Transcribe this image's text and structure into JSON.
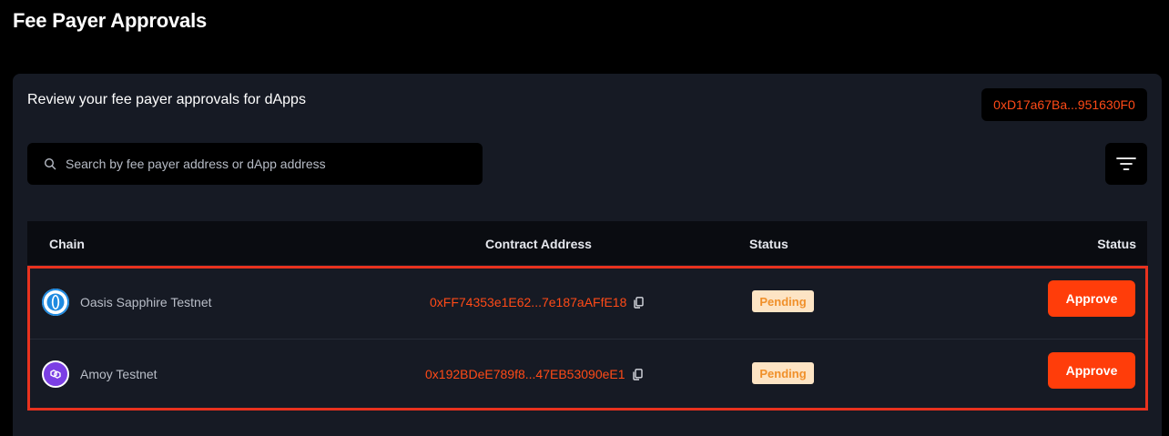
{
  "page": {
    "title": "Fee Payer Approvals"
  },
  "card": {
    "subtitle": "Review your fee payer approvals for dApps",
    "wallet_address": "0xD17a67Ba...951630F0"
  },
  "search": {
    "placeholder": "Search by fee payer address or dApp address",
    "value": ""
  },
  "filter": {
    "icon": "filter-icon"
  },
  "table": {
    "columns": [
      "Chain",
      "Contract Address",
      "Status",
      "Status"
    ],
    "rows": [
      {
        "chain": "Oasis Sapphire Testnet",
        "chain_icon": "oasis-sapphire-icon",
        "contract": "0xFF74353e1E62...7e187aAFfE18",
        "status": "Pending",
        "action": "Approve"
      },
      {
        "chain": "Amoy Testnet",
        "chain_icon": "polygon-amoy-icon",
        "contract": "0x192BDeE789f8...47EB53090eE1",
        "status": "Pending",
        "action": "Approve"
      }
    ]
  },
  "colors": {
    "accent": "#ff3d0a",
    "address_text": "#ff4a17",
    "pending_bg": "#fde4c4",
    "pending_text": "#f0902a",
    "highlight_border": "#e8321e"
  }
}
